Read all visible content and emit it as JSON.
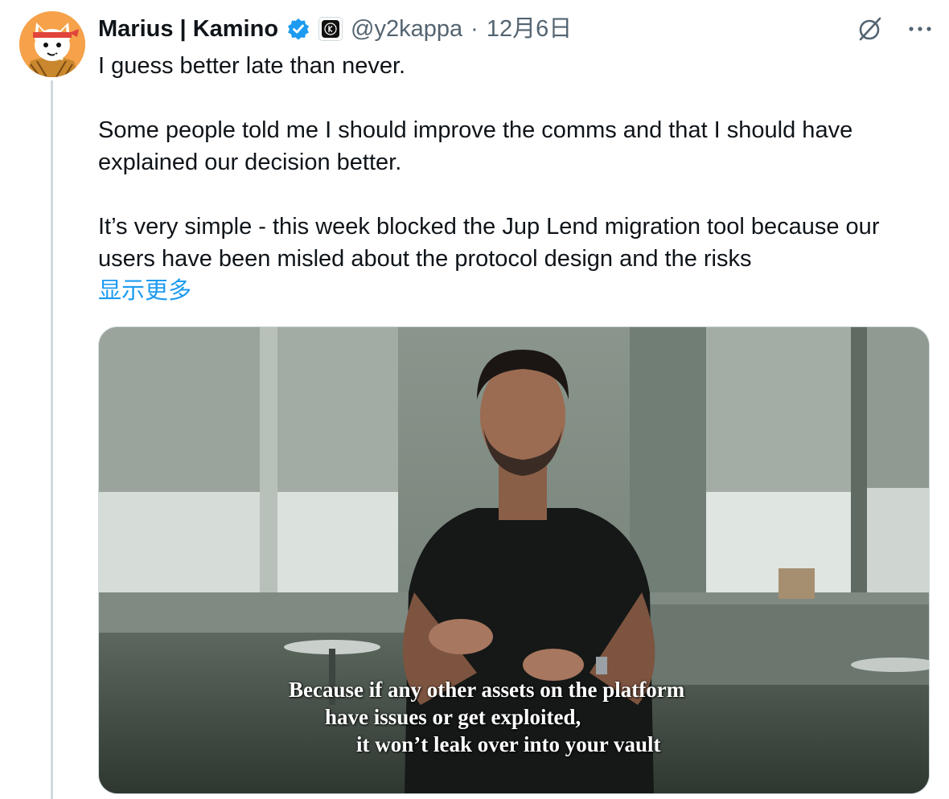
{
  "author": {
    "display_name": "Marius | Kamino",
    "handle": "@y2kappa",
    "separator": "·",
    "date": "12月6日",
    "verified_icon": "verified-badge-icon",
    "affiliate_icon": "kamino-affiliate-badge-icon",
    "avatar_icon": "cat-avatar"
  },
  "actions": {
    "grok_icon": "grok-icon",
    "more_icon": "more-options-icon"
  },
  "tweet": {
    "paragraphs": [
      "I guess better late than never.",
      "Some people told me I should improve the comms and that I should have explained our decision better.",
      "It’s very simple - this week blocked the Jup Lend migration tool because our users have been misled about the protocol design and the risks"
    ],
    "show_more": "显示更多"
  },
  "media": {
    "subtitles": [
      "Because if any other assets on the platform",
      "have issues or get exploited,",
      "it won’t leak over into your vault"
    ]
  },
  "colors": {
    "link": "#1d9bf0",
    "secondary_text": "#536471",
    "primary_text": "#0f1419",
    "thread_line": "#cfd9de",
    "verified": "#1d9bf0"
  }
}
